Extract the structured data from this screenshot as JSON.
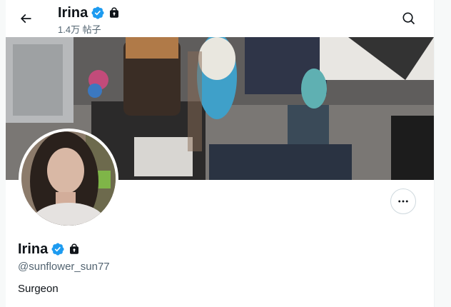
{
  "header": {
    "name": "Irina",
    "posts_count": "1.4万 帖子"
  },
  "profile": {
    "name": "Irina",
    "handle": "@sunflower_sun77",
    "bio": "Surgeon"
  },
  "icons": {
    "back": "arrow-left-icon",
    "search": "search-icon",
    "verified": "verified-badge-icon",
    "lock": "lock-icon",
    "more": "more-horizontal-icon"
  },
  "colors": {
    "verified": "#1d9bf0",
    "text": "#0f1419",
    "muted": "#536471",
    "border": "#cfd9de"
  }
}
